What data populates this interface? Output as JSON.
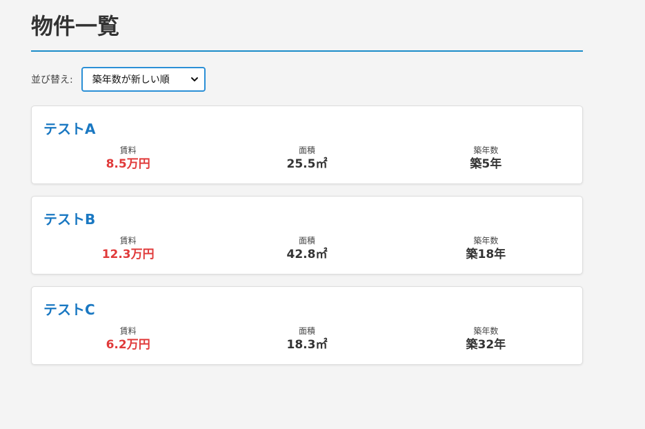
{
  "page": {
    "title": "物件一覧"
  },
  "sort": {
    "label": "並び替え:",
    "selected": "築年数が新しい順"
  },
  "stat_labels": {
    "rent": "賃料",
    "area": "面積",
    "age": "築年数"
  },
  "properties": [
    {
      "name": "テストA",
      "rent": "8.5万円",
      "area": "25.5㎡",
      "age": "築5年"
    },
    {
      "name": "テストB",
      "rent": "12.3万円",
      "area": "42.8㎡",
      "age": "築18年"
    },
    {
      "name": "テストC",
      "rent": "6.2万円",
      "area": "18.3㎡",
      "age": "築32年"
    }
  ],
  "colors": {
    "accent": "#1a8cc8",
    "title_link": "#1a78c2",
    "rent": "#e03a3a",
    "background": "#f4f4f4"
  }
}
